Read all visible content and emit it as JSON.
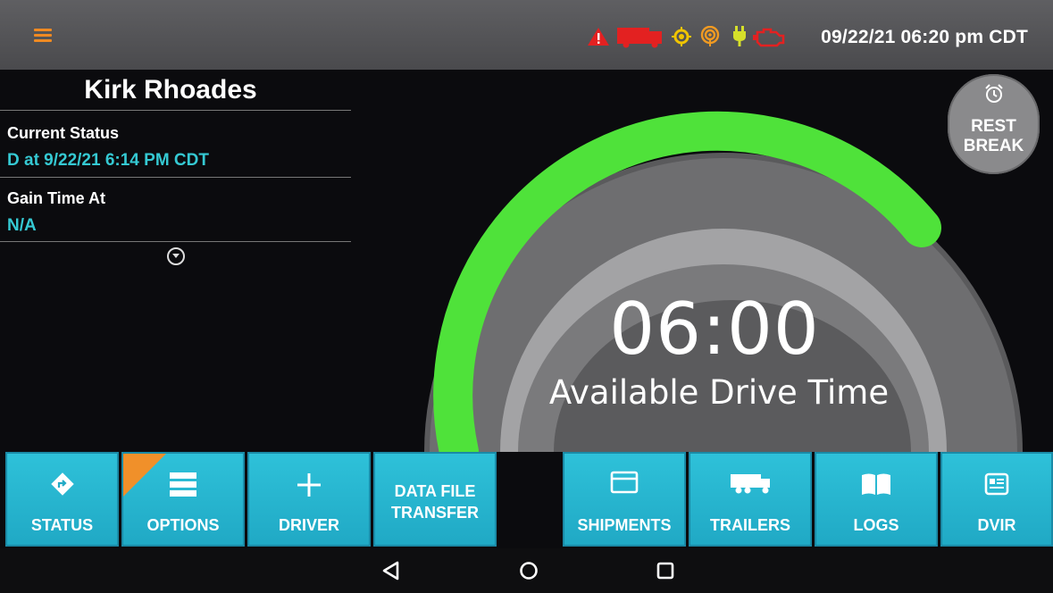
{
  "topbar": {
    "datetime": "09/22/21 06:20 pm CDT",
    "icons": [
      "menu-icon",
      "warning-icon",
      "truck-icon",
      "gps-icon",
      "signal-icon",
      "power-icon",
      "engine-icon"
    ],
    "colors": {
      "menu": "#f08a22",
      "warning": "#e32121",
      "truck": "#e32121",
      "gps": "#f0c400",
      "signal": "#f09a22",
      "power": "#d6e02a",
      "engine": "#e32121"
    }
  },
  "driver": {
    "name": "Kirk Rhoades",
    "current_status_label": "Current Status",
    "current_status_value": "D at 9/22/21 6:14 PM CDT",
    "gain_time_label": "Gain Time At",
    "gain_time_value": "N/A"
  },
  "gauge": {
    "time": "06:00",
    "caption": "Available Drive Time",
    "arc_color": "#4fe23a"
  },
  "rest_break": {
    "label_line1": "REST",
    "label_line2": "BREAK"
  },
  "buttons": {
    "status": "STATUS",
    "options": "OPTIONS",
    "driver": "DRIVER",
    "data_file_line1": "DATA FILE",
    "data_file_line2": "TRANSFER",
    "shipments": "SHIPMENTS",
    "trailers": "TRAILERS",
    "logs": "LOGS",
    "dvir": "DVIR"
  },
  "nav": [
    "back-icon",
    "home-icon",
    "recents-icon"
  ]
}
